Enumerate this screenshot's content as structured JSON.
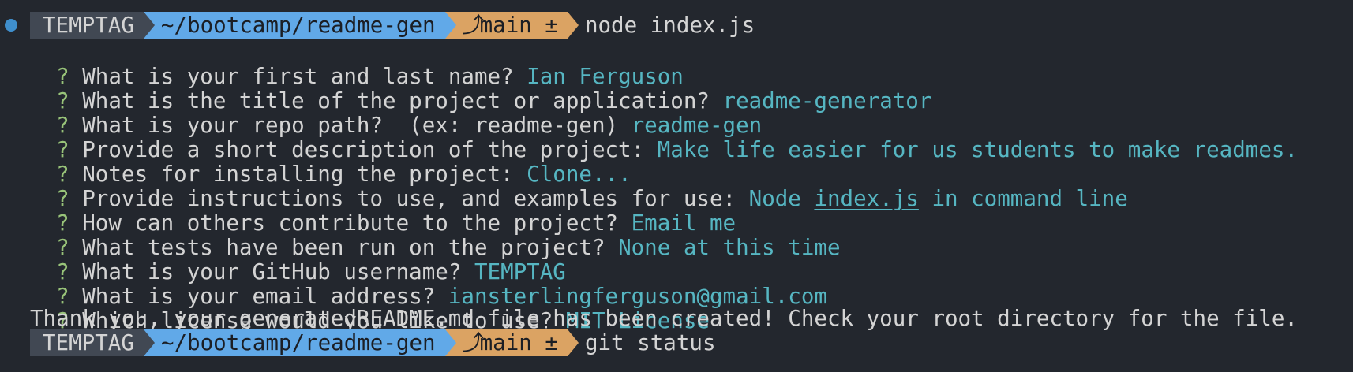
{
  "prompt": {
    "user": "TEMPTAG",
    "dir": "~/bootcamp/readme-gen",
    "branch_glyph": "⤴",
    "branch": "main ±",
    "command1": "node index.js",
    "command2": "git status"
  },
  "qa": [
    {
      "q": "What is your first and last name? ",
      "a": "Ian Ferguson"
    },
    {
      "q": "What is the title of the project or application? ",
      "a": "readme-generator"
    },
    {
      "q": "What is your repo path?  (ex: readme-gen) ",
      "a": "readme-gen"
    },
    {
      "q": "Provide a short description of the project: ",
      "a": "Make life easier for us students to make readmes."
    },
    {
      "q": "Notes for installing the project: ",
      "a": "Clone..."
    },
    {
      "q": "Provide instructions to use, and examples for use: ",
      "a_pre": "Node ",
      "a_link": "index.js",
      "a_post": " in command line"
    },
    {
      "q": "How can others contribute to the project? ",
      "a": "Email me"
    },
    {
      "q": "What tests have been run on the project? ",
      "a": "None at this time"
    },
    {
      "q": "What is your GitHub username? ",
      "a": "TEMPTAG"
    },
    {
      "q": "What is your email address? ",
      "a": "iansterlingferguson@gmail.com"
    },
    {
      "q": "Which license would you like to use? ",
      "a": "MIT License"
    }
  ],
  "question_mark": "?",
  "final_message": "Thank you, your generatedREADME.md file has been created! Check your root directory for the file.",
  "colors": {
    "background": "#23272e",
    "question": "#98c379",
    "answer": "#56b6c2",
    "user_segment": "#414853",
    "dir_segment": "#61a9e8",
    "git_segment": "#dba363",
    "dot": "#3f8fcd"
  }
}
